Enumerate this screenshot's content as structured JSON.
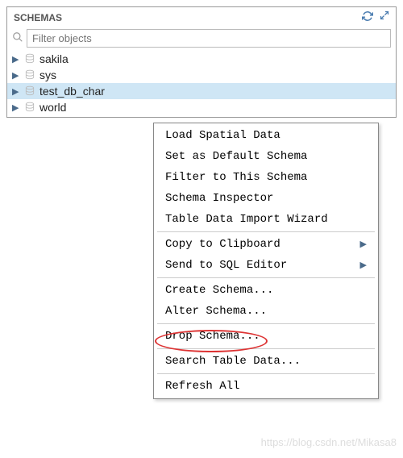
{
  "panel": {
    "title": "SCHEMAS"
  },
  "search": {
    "placeholder": "Filter objects"
  },
  "schemas": [
    {
      "name": "sakila"
    },
    {
      "name": "sys"
    },
    {
      "name": "test_db_char"
    },
    {
      "name": "world"
    }
  ],
  "context_menu": {
    "items": [
      {
        "label": "Load Spatial Data",
        "sep": false,
        "submenu": false
      },
      {
        "label": "Set as Default Schema",
        "sep": false,
        "submenu": false
      },
      {
        "label": "Filter to This Schema",
        "sep": false,
        "submenu": false
      },
      {
        "label": "Schema Inspector",
        "sep": false,
        "submenu": false
      },
      {
        "label": "Table Data Import Wizard",
        "sep": true,
        "submenu": false
      },
      {
        "label": "Copy to Clipboard",
        "sep": false,
        "submenu": true
      },
      {
        "label": "Send to SQL Editor",
        "sep": true,
        "submenu": true
      },
      {
        "label": "Create Schema...",
        "sep": false,
        "submenu": false
      },
      {
        "label": "Alter Schema...",
        "sep": true,
        "submenu": false
      },
      {
        "label": "Drop Schema...",
        "sep": true,
        "submenu": false
      },
      {
        "label": "Search Table Data...",
        "sep": true,
        "submenu": false
      },
      {
        "label": "Refresh All",
        "sep": false,
        "submenu": false
      }
    ]
  },
  "watermark": "https://blog.csdn.net/Mikasa8"
}
